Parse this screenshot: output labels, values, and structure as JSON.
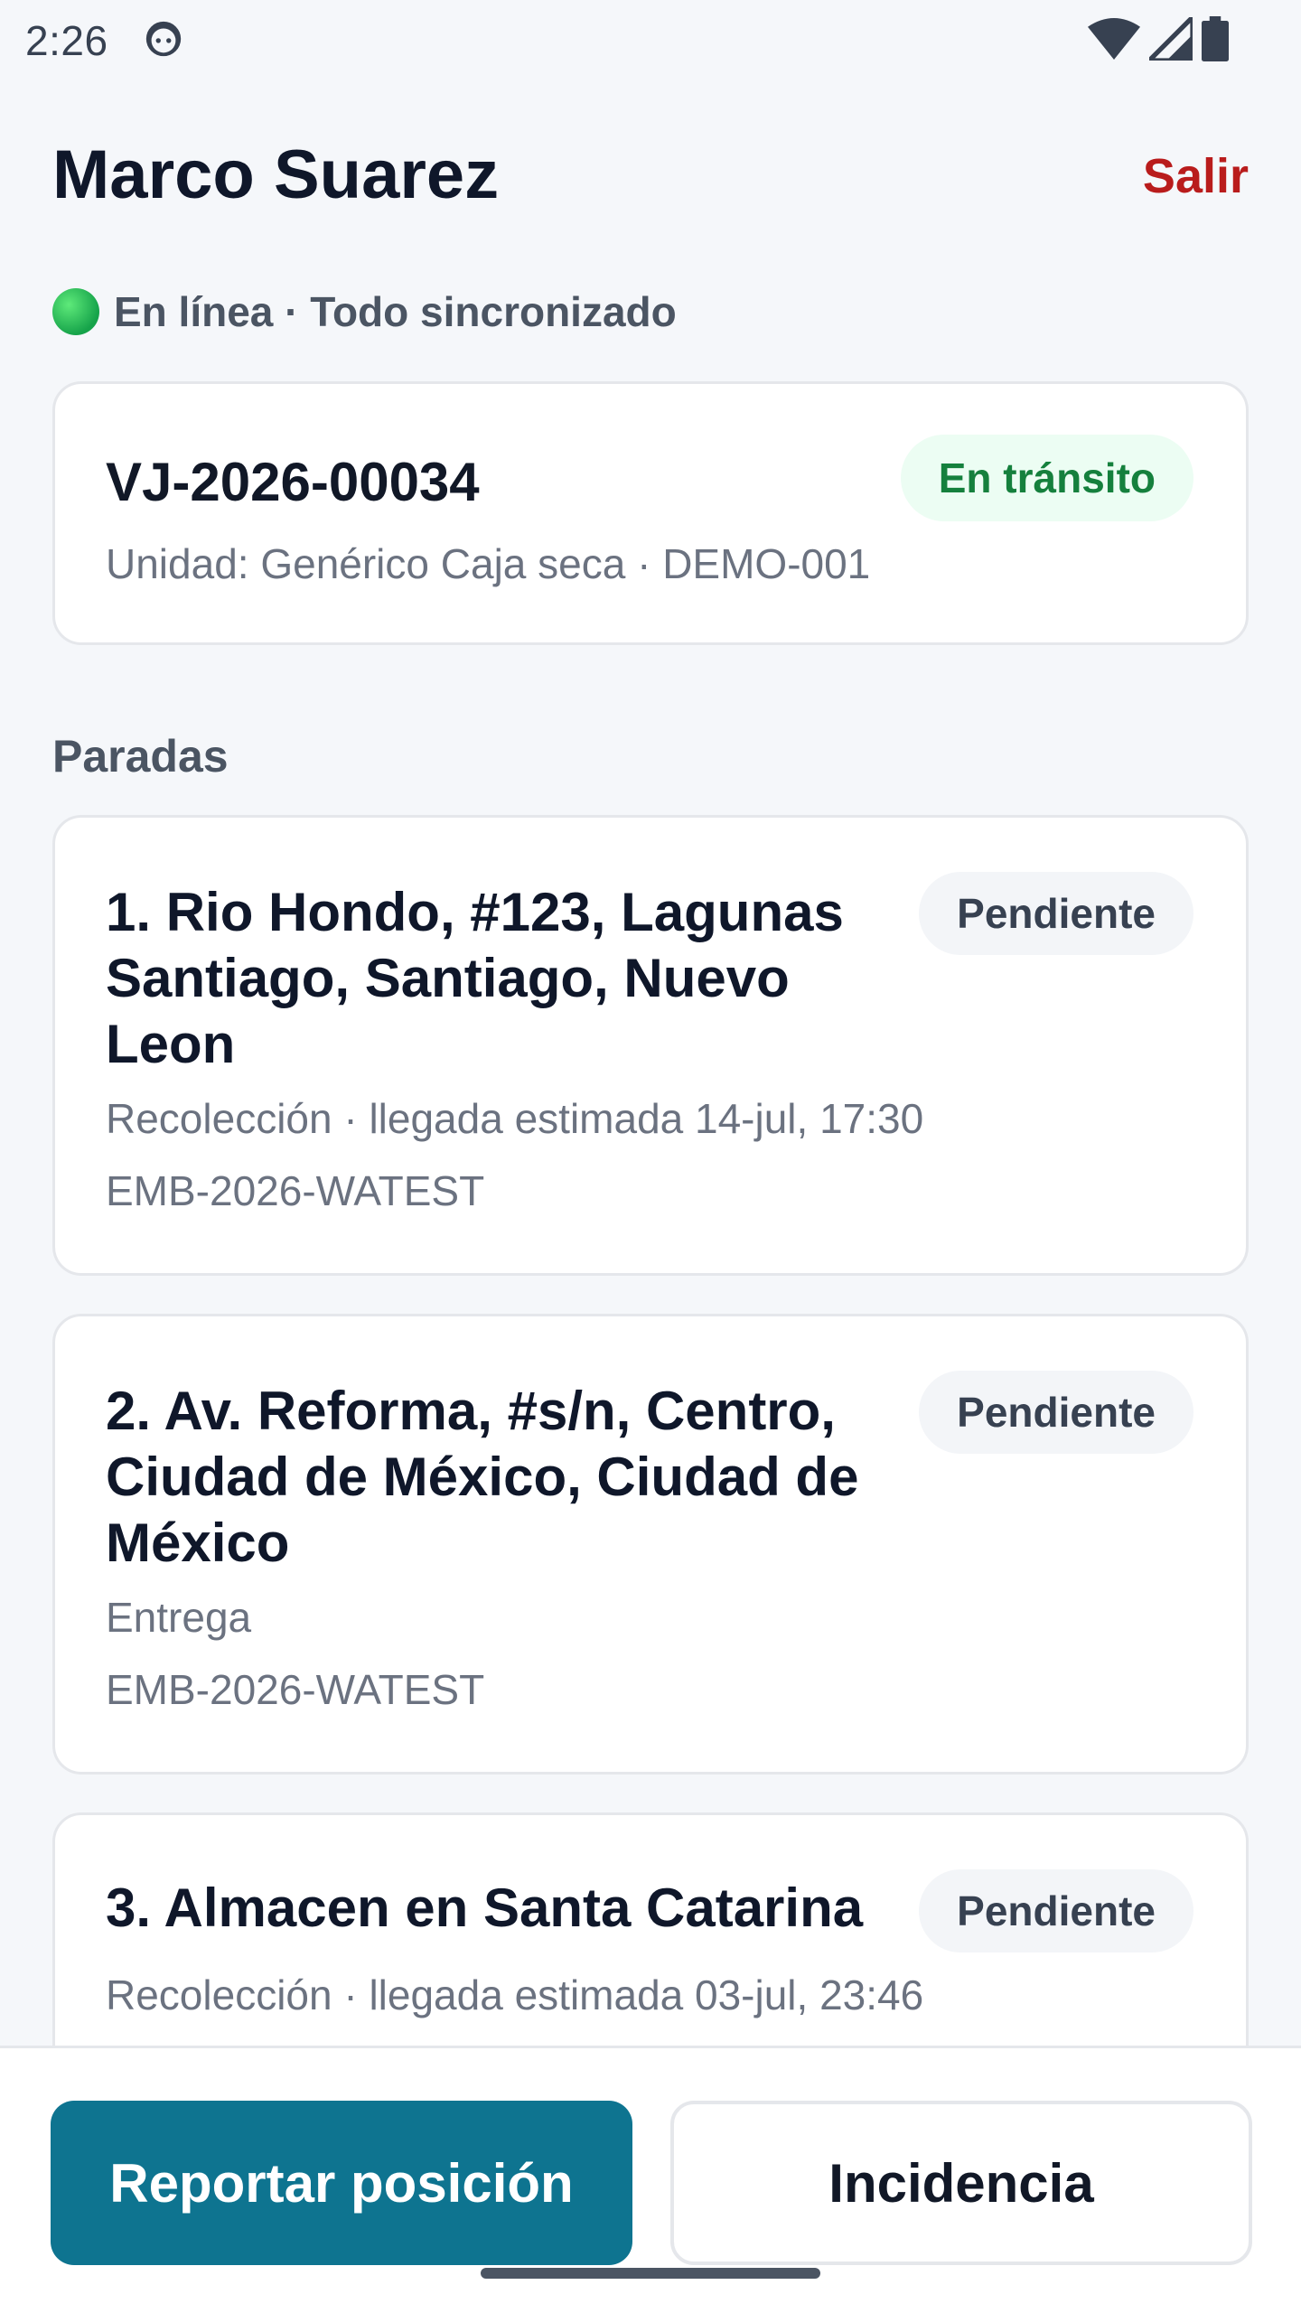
{
  "status_bar": {
    "time": "2:26",
    "icons": [
      "android-face-icon",
      "wifi-icon",
      "signal-icon",
      "battery-icon"
    ]
  },
  "header": {
    "driver_name": "Marco Suarez",
    "logout_label": "Salir"
  },
  "sync_status": {
    "indicator_color": "#22c55e",
    "text": "En línea · Todo sincronizado"
  },
  "trip": {
    "code": "VJ-2026-00034",
    "unit": "Unidad: Genérico Caja seca · DEMO-001",
    "status": "En tránsito"
  },
  "stops_section_title": "Paradas",
  "stops": [
    {
      "title": "1. Rio Hondo, #123, Lagunas Santiago, Santiago, Nuevo Leon",
      "meta": "Recolección · llegada estimada 14-jul, 17:30",
      "shipment": "EMB-2026-WATEST",
      "status": "Pendiente"
    },
    {
      "title": "2. Av. Reforma, #s/n, Centro, Ciudad de México, Ciudad de México",
      "meta": "Entrega",
      "shipment": "EMB-2026-WATEST",
      "status": "Pendiente"
    },
    {
      "title": "3. Almacen en Santa Catarina",
      "meta": "Recolección · llegada estimada 03-jul, 23:46",
      "shipment": "",
      "status": "Pendiente"
    }
  ],
  "actions": {
    "report_position": "Reportar posición",
    "incident": "Incidencia"
  },
  "colors": {
    "primary": "#0e7490",
    "danger": "#b91c1c",
    "success": "#15803d"
  }
}
